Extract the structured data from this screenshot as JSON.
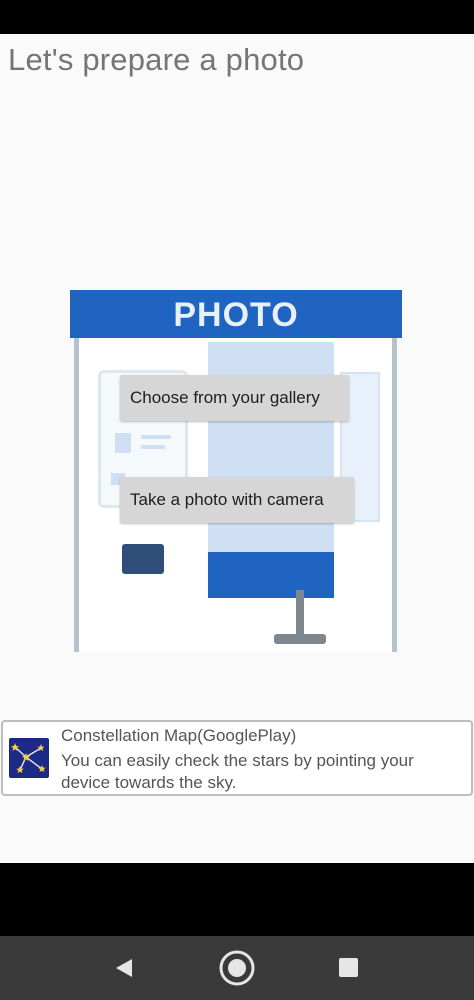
{
  "page": {
    "title": "Let's prepare a photo"
  },
  "illustration": {
    "sign_text": "PHOTO"
  },
  "buttons": {
    "gallery_label": "Choose from your gallery",
    "camera_label": "Take a photo with camera"
  },
  "ad": {
    "title": "Constellation Map(GooglePlay)",
    "description": "You can easily check the stars by pointing your device towards the sky.",
    "icon": "constellation-icon"
  },
  "nav": {
    "back": "back-icon",
    "home": "home-icon",
    "recents": "recents-icon"
  },
  "colors": {
    "booth_blue": "#1f64c1",
    "button_gray": "#d6d6d6",
    "title_gray": "#757575",
    "nav_bar": "#3a3a3a"
  }
}
